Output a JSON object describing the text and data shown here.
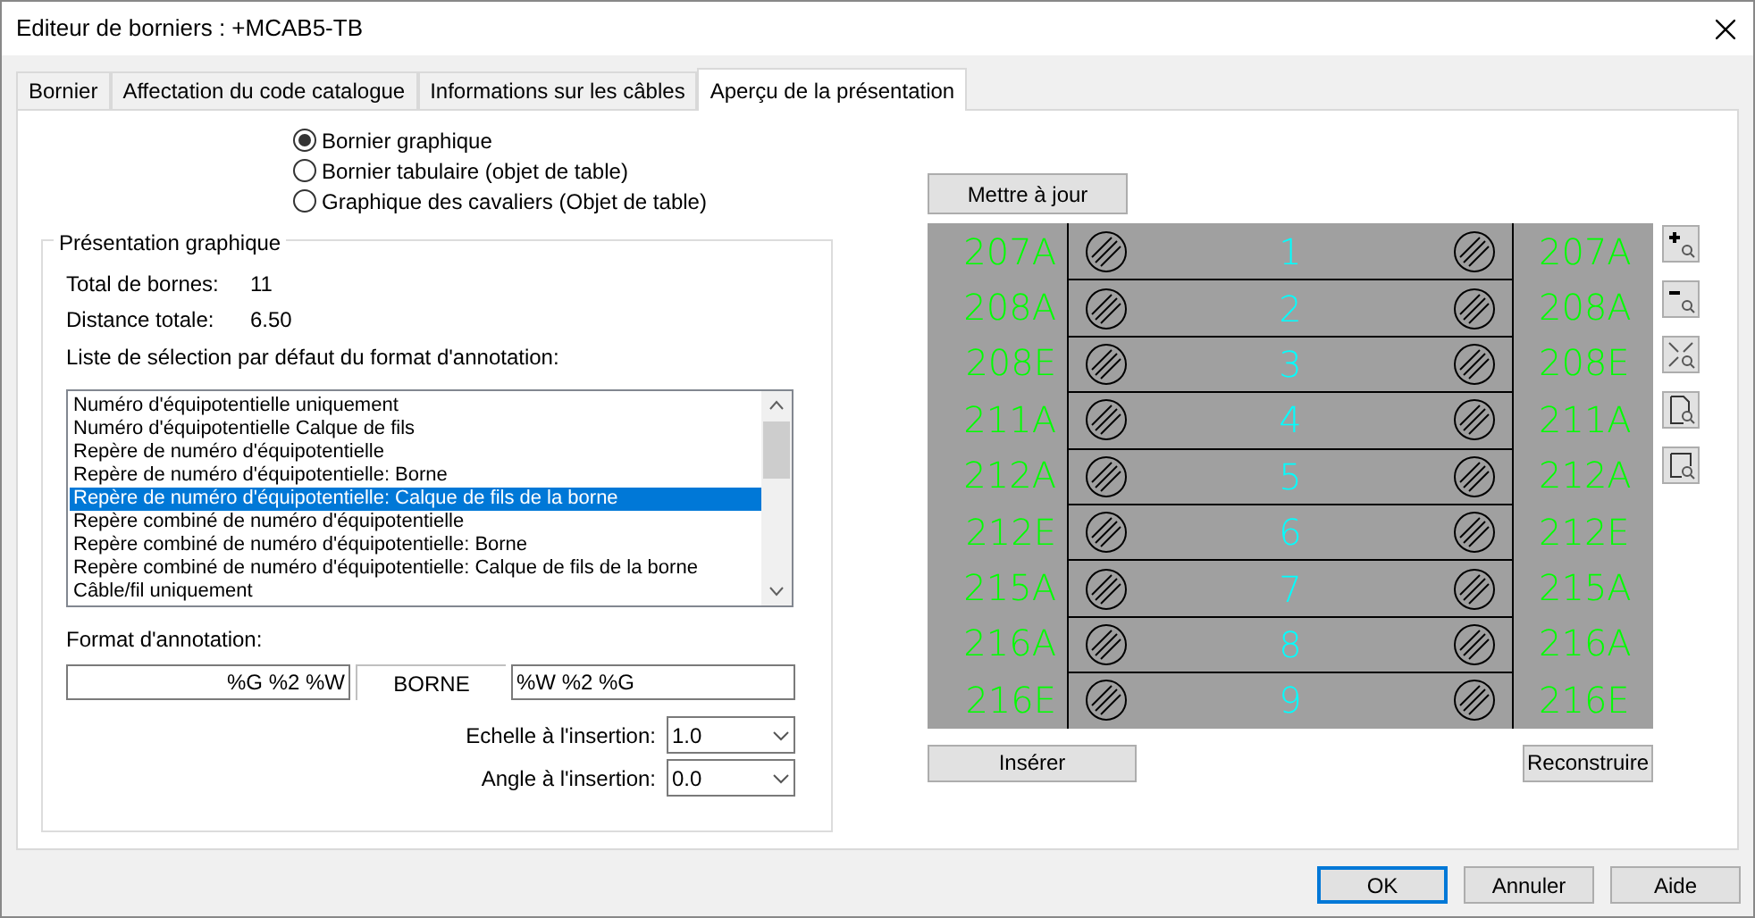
{
  "window": {
    "title": "Editeur de borniers : +MCAB5-TB"
  },
  "tabs": [
    {
      "label": "Bornier",
      "selected": false
    },
    {
      "label": "Affectation du code catalogue",
      "selected": false
    },
    {
      "label": "Informations sur les câbles",
      "selected": false
    },
    {
      "label": "Aperçu de la présentation",
      "selected": true
    }
  ],
  "layout_options": [
    {
      "label": "Bornier graphique",
      "selected": true
    },
    {
      "label": "Bornier tabulaire (objet de table)",
      "selected": false
    },
    {
      "label": "Graphique des cavaliers (Objet de table)",
      "selected": false
    }
  ],
  "graphic_presentation": {
    "title": "Présentation graphique",
    "stats": [
      {
        "label": "Total de bornes:",
        "value": "11"
      },
      {
        "label": "Distance totale:",
        "value": "6.50"
      }
    ],
    "list_label": "Liste de sélection par défaut du format d'annotation:",
    "list": [
      {
        "label": "Numéro d'équipotentielle uniquement",
        "selected": false
      },
      {
        "label": "Numéro d'équipotentielle Calque de fils",
        "selected": false
      },
      {
        "label": "Repère de numéro d'équipotentielle",
        "selected": false
      },
      {
        "label": "Repère de numéro d'équipotentielle: Borne",
        "selected": false
      },
      {
        "label": "Repère de numéro d'équipotentielle: Calque de fils de la borne",
        "selected": true
      },
      {
        "label": "Repère combiné de numéro d'équipotentielle",
        "selected": false
      },
      {
        "label": "Repère combiné de numéro d'équipotentielle: Borne",
        "selected": false
      },
      {
        "label": "Repère combiné de numéro d'équipotentielle: Calque de fils de la borne",
        "selected": false
      },
      {
        "label": "Câble/fil uniquement",
        "selected": false
      }
    ],
    "format_label": "Format d'annotation:",
    "format_parts": [
      {
        "kind": "field-right",
        "value": "%G %2 %W"
      },
      {
        "kind": "label",
        "value": "BORNE"
      },
      {
        "kind": "field-left",
        "value": "%W %2 %G"
      }
    ],
    "insertion": [
      {
        "label": "Echelle à l'insertion:",
        "value": "1.0"
      },
      {
        "label": "Angle à l'insertion:",
        "value": "0.0"
      }
    ]
  },
  "preview": {
    "update_button": "Mettre à jour",
    "terminals": [
      {
        "left": "207A",
        "number": "1",
        "right": "207A"
      },
      {
        "left": "208A",
        "number": "2",
        "right": "208A"
      },
      {
        "left": "208E",
        "number": "3",
        "right": "208E"
      },
      {
        "left": "211A",
        "number": "4",
        "right": "211A"
      },
      {
        "left": "212A",
        "number": "5",
        "right": "212A"
      },
      {
        "left": "212E",
        "number": "6",
        "right": "212E"
      },
      {
        "left": "215A",
        "number": "7",
        "right": "215A"
      },
      {
        "left": "216A",
        "number": "8",
        "right": "216A"
      },
      {
        "left": "216E",
        "number": "9",
        "right": "216E"
      }
    ],
    "zoom_tools": [
      {
        "kind": "zoom-in"
      },
      {
        "kind": "zoom-out"
      },
      {
        "kind": "zoom-extents"
      },
      {
        "kind": "zoom-page"
      },
      {
        "kind": "zoom-window"
      }
    ],
    "insert_button": "Insérer",
    "rebuild_button": "Reconstruire"
  },
  "buttons": [
    {
      "label": "OK",
      "default": true
    },
    {
      "label": "Annuler",
      "default": false
    },
    {
      "label": "Aide",
      "default": false
    }
  ]
}
